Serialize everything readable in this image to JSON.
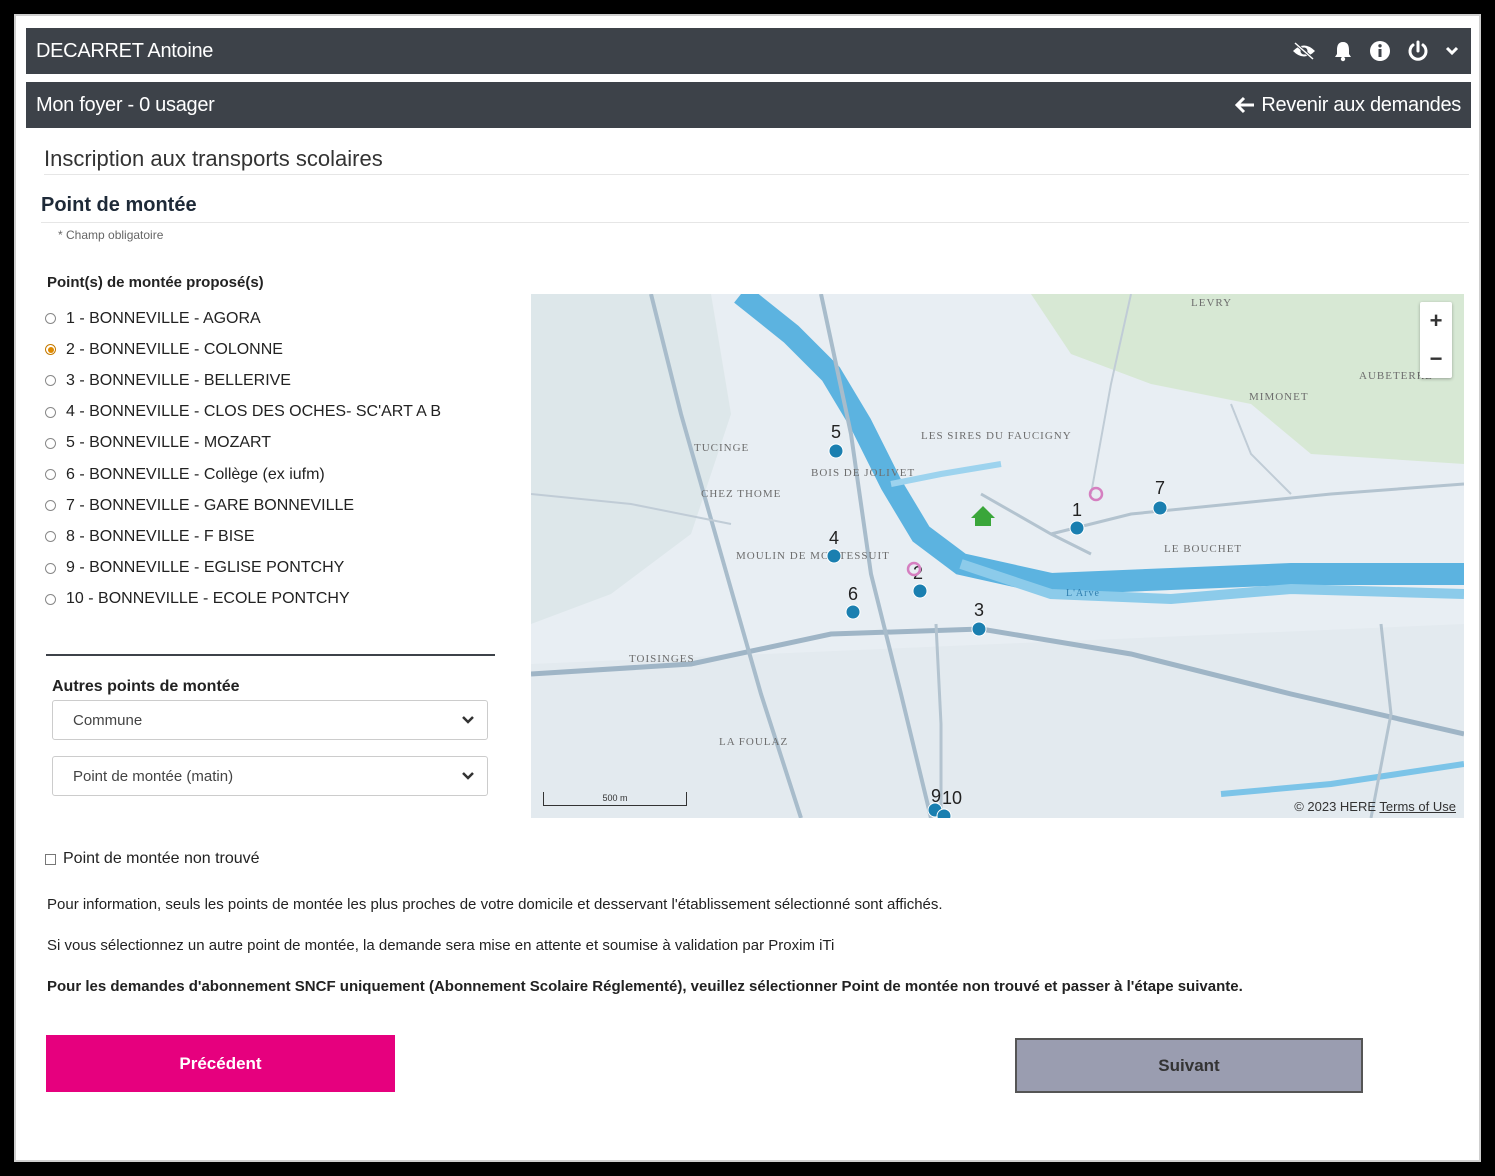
{
  "header": {
    "user_name": "DECARRET Antoine",
    "icons": [
      "eye-slash-icon",
      "bell-icon",
      "info-icon",
      "power-icon",
      "chevron-down-icon"
    ]
  },
  "subheader": {
    "household": "Mon foyer - 0 usager",
    "back_label": "Revenir aux demandes"
  },
  "page": {
    "title": "Inscription aux transports scolaires",
    "section_title": "Point de montée",
    "required_note": "* Champ obligatoire"
  },
  "proposed": {
    "label": "Point(s) de montée proposé(s)",
    "selected_index": 1,
    "options": [
      "1 - BONNEVILLE - AGORA",
      "2 - BONNEVILLE - COLONNE",
      "3 - BONNEVILLE - BELLERIVE",
      "4 - BONNEVILLE - CLOS DES OCHES- SC'ART A B",
      "5 - BONNEVILLE - MOZART",
      "6 - BONNEVILLE - Collège (ex iufm)",
      "7 - BONNEVILLE - GARE BONNEVILLE",
      "8 - BONNEVILLE - F BISE",
      "9 - BONNEVILLE - EGLISE PONTCHY",
      "10 - BONNEVILLE - ECOLE PONTCHY"
    ]
  },
  "other": {
    "label": "Autres points de montée",
    "commune_value": "Commune",
    "point_value": "Point de montée (matin)"
  },
  "map": {
    "zoom_in": "+",
    "zoom_out": "−",
    "attribution": "© 2023 HERE",
    "terms": "Terms of Use",
    "scale": "500 m",
    "places": [
      "LEVRY",
      "MIMONET",
      "AUBETERRE",
      "LES SIRES DU FAUCIGNY",
      "TUCINGE",
      "BOIS DE JOLIVET",
      "CHEZ THOME",
      "MOULIN DE MONTESSUIT",
      "LE BOUCHET",
      "TOISINGES",
      "LA FOULAZ",
      "L'Arve"
    ],
    "marker_labels": [
      "1",
      "2",
      "3",
      "4",
      "5",
      "6",
      "7",
      "9",
      "10"
    ]
  },
  "not_found": {
    "label": "Point de montée non trouvé"
  },
  "info": {
    "line1": "Pour information, seuls les points de montée les plus proches de votre domicile et desservant l'établissement sélectionné sont affichés.",
    "line2": "Si vous sélectionnez un autre point de montée, la demande sera mise en attente et soumise à validation par Proxim iTi",
    "line3": "Pour les demandes d'abonnement SNCF uniquement (Abonnement Scolaire Réglementé), veuillez sélectionner Point de montée non trouvé et passer à l'étape suivante."
  },
  "buttons": {
    "previous": "Précédent",
    "next": "Suivant"
  },
  "colors": {
    "header_bg": "#3d4249",
    "primary_pink": "#e6007e",
    "next_bg": "#9a9db0",
    "marker_blue": "#1a7fb0",
    "river": "#4aa8d8"
  }
}
